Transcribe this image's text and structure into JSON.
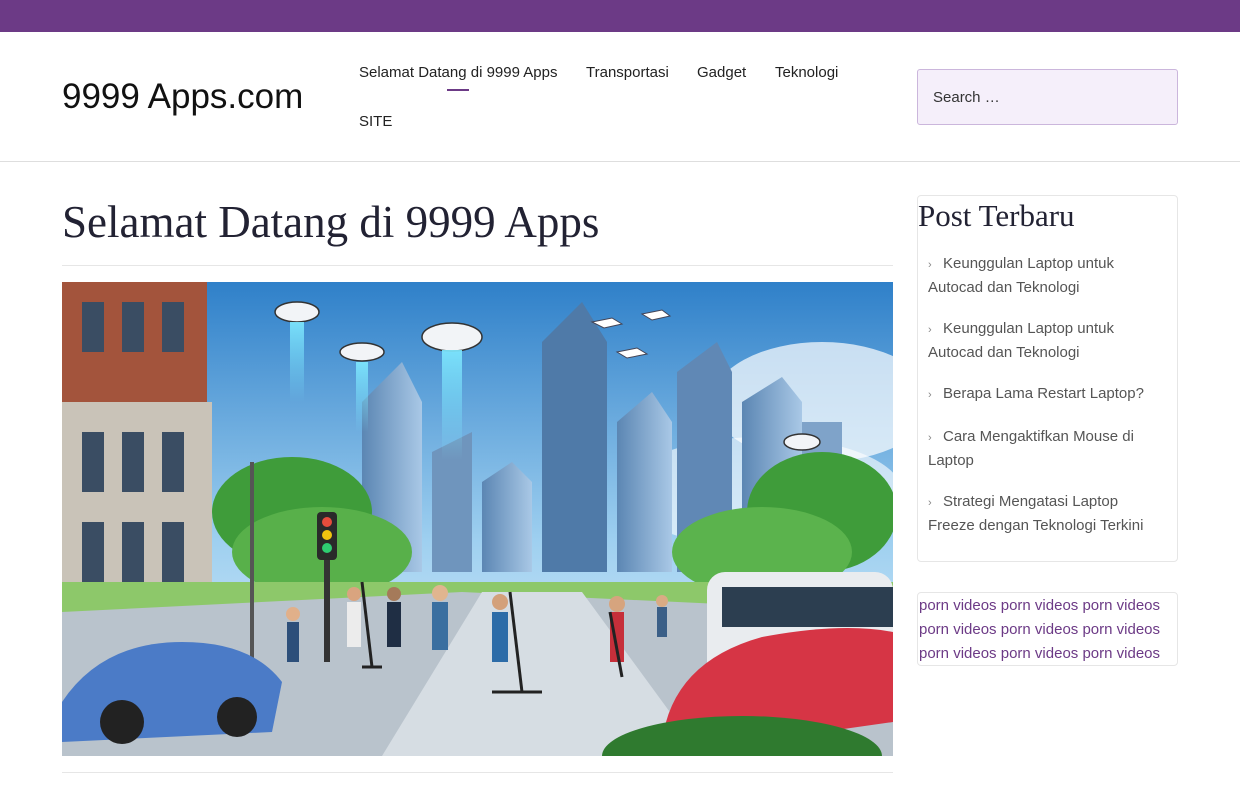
{
  "colors": {
    "accent": "#6c3a86",
    "search_bg": "#f5effa",
    "title_text": "#223344"
  },
  "site": {
    "title": "9999 Apps.com"
  },
  "nav": {
    "items": [
      {
        "label": "Selamat Datang di 9999 Apps",
        "active": true
      },
      {
        "label": "Transportasi"
      },
      {
        "label": "Gadget"
      },
      {
        "label": "Teknologi"
      },
      {
        "label": "SITE"
      }
    ]
  },
  "search": {
    "placeholder": "Search …"
  },
  "main": {
    "page_title": "Selamat Datang di 9999 Apps"
  },
  "sidebar": {
    "recent_title": "Post Terbaru",
    "recent_posts": [
      {
        "icon": "chevron-right-icon",
        "label": "Keunggulan Laptop untuk Autocad dan Teknologi"
      },
      {
        "icon": "chevron-right-icon",
        "label": "Keunggulan Laptop untuk Autocad dan Teknologi"
      },
      {
        "icon": "chevron-right-icon",
        "label": "Berapa Lama Restart Laptop?"
      },
      {
        "icon": "chevron-right-icon",
        "label": "Cara Mengaktifkan Mouse di Laptop"
      },
      {
        "icon": "chevron-right-icon",
        "label": "Strategi Mengatasi Laptop Freeze dengan Teknologi Terkini"
      }
    ],
    "links": [
      "porn videos",
      "porn videos",
      "porn videos",
      "porn videos",
      "porn videos",
      "porn videos",
      "porn videos",
      "porn videos",
      "porn videos"
    ]
  }
}
